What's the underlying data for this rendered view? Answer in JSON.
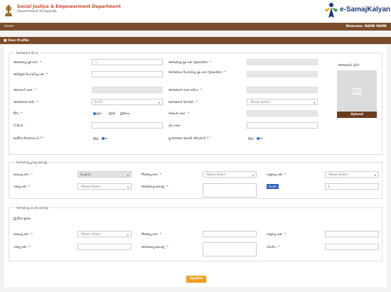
{
  "header": {
    "dept_title": "Social Justice & Empowerment Department",
    "dept_sub": "(Government of Gujarat)",
    "logo_text": "e-SamajKalyan"
  },
  "nav": {
    "home": "Home",
    "welcome": "Welcome, NAME NAME"
  },
  "page": {
    "title": "User Profile"
  },
  "sections": {
    "applicant": "અરજદારની વિગતો",
    "current_address": "અરજદારનું હાલનું સરનામું",
    "permanent_address": "અરજદારનું કાયમી સરનામું"
  },
  "applicant": {
    "name_label": "અરજદારનું પૂરું નામ : *",
    "name_value": "ા",
    "name_guj_label": "અરજદારનું પૂરું નામ (ગુજરાતીમાં) : *",
    "father_label": "અંગ્રેજીમાં પિતા/પતિનું નામ : *",
    "father_guj_label": "અરજદારના પિતા/પતિનું પૂરું નામ (ગુજરાતીમાં) : *",
    "aadhaar_label": "આધારકાર્ડ નંબર : *",
    "dob_label": "અરજદારની જન્મ તારીખ : *",
    "caste_label": "અરજદારની જાતિ : *",
    "caste_value": "SC/ST",
    "subcaste_label": "અરજદારની પેટાજાતિ : *",
    "subcaste_value": "-Please Select-",
    "gender_label": "લિંગ : *",
    "gender_options": [
      "પુરુષ",
      "સ્ત્રી",
      "અન્ય"
    ],
    "mobile_label": "મોબાઇલ નંબર : *",
    "email_label": "ઈ-મેઇલ :",
    "phone_label": "ફોન નંબર :",
    "disabled_label": "શારીરિક વિકલાંગતા છે ? *",
    "disabled_options": [
      "હા",
      "ના"
    ],
    "govt_emp_label": "શુ અરજદાર સરકારી કર્મચારી છે ? *",
    "govt_emp_options": [
      "હા",
      "ના"
    ],
    "photo_label": "અરજદારનો ફોટો*",
    "upload_label": "Upload"
  },
  "current_address": {
    "state_label": "રાજ્યનું નામ : *",
    "state_value": "Gujarat",
    "district_label": "જિલ્લાનું નામ : *",
    "district_value": "-Please Select-",
    "taluka_label": "તાલુકાનું નામ : *",
    "taluka_value": "-Please Select-",
    "village_label": "ગામનું નામ : *",
    "village_value": "-Please Select-",
    "address_label": "અરજદારનું સરનામું : *",
    "pincode_label": "પીનકોડ",
    "pincode_value": "1"
  },
  "permanent_address": {
    "same_label": "ઉપર મુજબ",
    "state_label": "રાજ્યનું નામ : *",
    "state_value": "-Please Select-",
    "district_label": "જિલ્લાનું નામ : *",
    "taluka_label": "તાલુકાનું નામ : *",
    "village_label": "ગામનું નામ : *",
    "address_label": "અરજદારનું સરનામું : *",
    "pincode_label": "પીનકોડ : *"
  },
  "update_label": "Update",
  "colors": {
    "nav_brown": "#7a4b2a",
    "title_red": "#c8462c",
    "logo_blue": "#1e3a78",
    "update_orange": "#f0a020"
  }
}
